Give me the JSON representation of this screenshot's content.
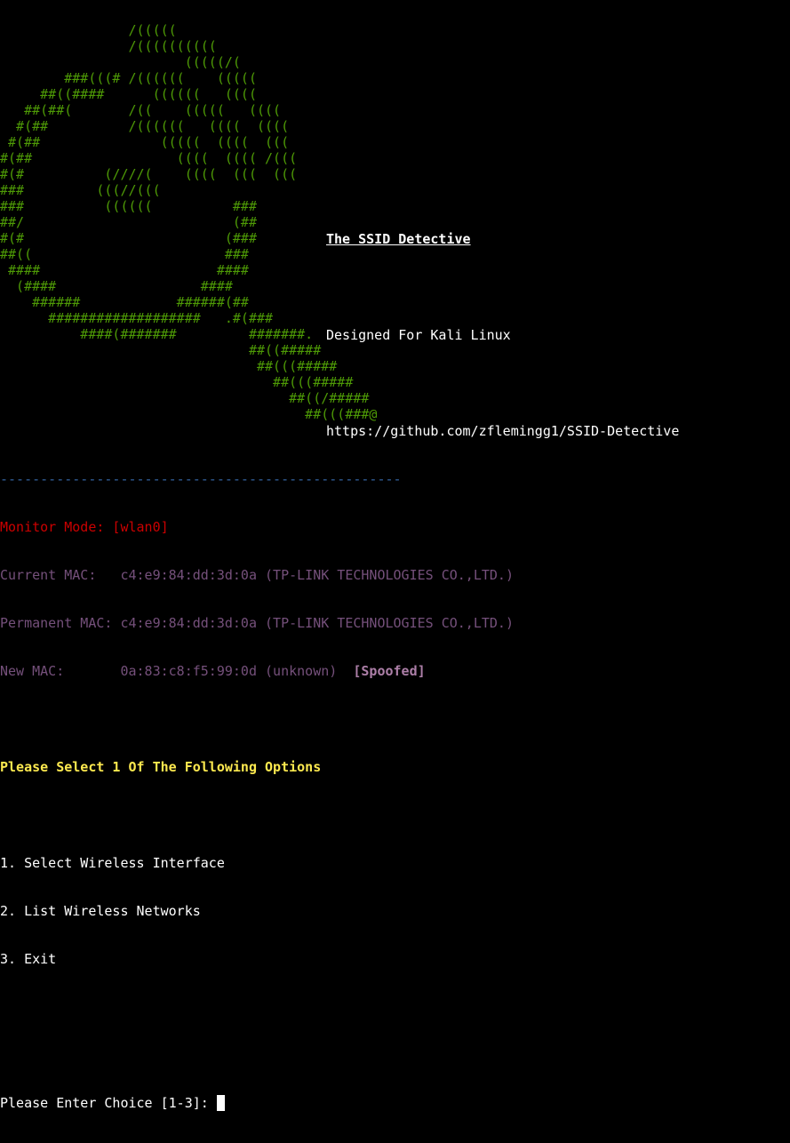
{
  "banner": {
    "ascii_art": "                /(((((\n                /((((((((((\n                       (((((/(\n        ###(((# /((((((    (((((\n     ##((####      ((((((   ((((\n   ##(##(       /((    (((((   ((((\n  #(##          /((((((   ((((  ((((\n #(##               (((((  ((((  (((\n#(##                  ((((  (((( /(((\n#(#          (////(    ((((  (((  (((\n###         (((//(((\n###          ((((((          ###\n##/                          (##\n#(#                         (###\n##((                        ###\n ####                      ####\n  (####                  ####\n    ######            ######(##\n      ###################   .#(###\n          ####(#######         #######.\n                               ##((#####\n                                ##(((#####\n                                  ##(((#####\n                                    ##((/#####\n                                      ##(((###@",
    "title": "The SSID Detective",
    "subtitle": "Designed For Kali Linux",
    "url": "https://github.com/zflemingg1/SSID-Detective"
  },
  "status": {
    "divider": "--------------------------------------------------",
    "monitor_mode": "Monitor Mode: [wlan0]",
    "current_mac": "Current MAC:   c4:e9:84:dd:3d:0a (TP-LINK TECHNOLOGIES CO.,LTD.)",
    "permanent_mac": "Permanent MAC: c4:e9:84:dd:3d:0a (TP-LINK TECHNOLOGIES CO.,LTD.)",
    "new_mac": "New MAC:       0a:83:c8:f5:99:0d (unknown)  ",
    "spoofed_tag": "[Spoofed]"
  },
  "menu": {
    "heading": "Please Select 1 Of The Following Options",
    "options": [
      "1. Select Wireless Interface",
      "2. List Wireless Networks",
      "3. Exit"
    ]
  },
  "prompt": {
    "text": "Please Enter Choice [1-3]: "
  },
  "colors": {
    "background": "#000000",
    "ascii_green": "#4e9a06",
    "divider_blue": "#3465a4",
    "monitor_red": "#cc0000",
    "mac_purple": "#75507b",
    "heading_yellow": "#fce94f",
    "text_white": "#ffffff"
  }
}
